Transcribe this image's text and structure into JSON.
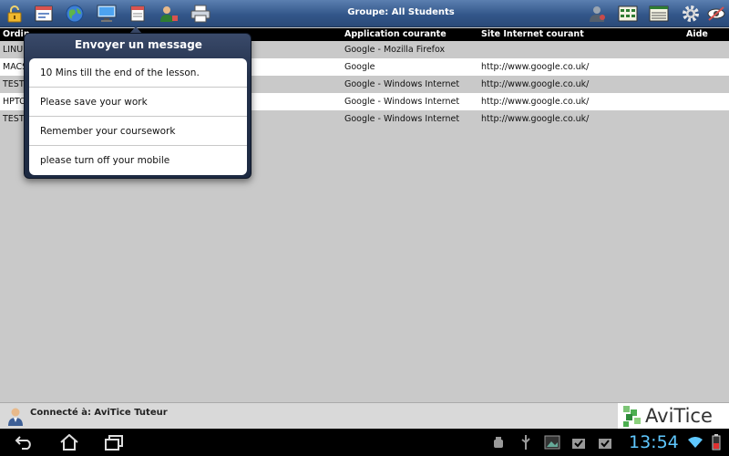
{
  "toolbar": {
    "title": "Groupe: All Students",
    "left_icons": [
      "lock-icon",
      "calendar-window-icon",
      "globe-icon",
      "monitor-icon",
      "message-icon",
      "user-add-icon",
      "printer-icon"
    ],
    "right_icons": [
      "user-settings-icon",
      "grid-view-icon",
      "list-view-icon",
      "gear-icon",
      "eye-off-icon"
    ]
  },
  "table": {
    "columns": [
      "Ordin",
      "Application courante",
      "Site Internet courant",
      "Aide"
    ],
    "rows": [
      {
        "name": "LINU",
        "app": "Google - Mozilla Firefox",
        "site": ""
      },
      {
        "name": "MACS",
        "app": "Google",
        "site": "http://www.google.co.uk/"
      },
      {
        "name": "TEST",
        "app": "Google - Windows Internet",
        "site": "http://www.google.co.uk/"
      },
      {
        "name": "HPTC",
        "app": "Google - Windows Internet",
        "site": "http://www.google.co.uk/"
      },
      {
        "name": "TEST",
        "app": "Google - Windows Internet",
        "site": "http://www.google.co.uk/"
      }
    ]
  },
  "popup": {
    "title": "Envoyer un message",
    "items": [
      "10 Mins till the end of the lesson.",
      "Please save your work",
      "Remember your coursework",
      "please turn off your mobile"
    ]
  },
  "status": {
    "connected_text": "Connecté à: AviTice Tuteur",
    "logo_text": "AviTice"
  },
  "system": {
    "clock": "13:54"
  },
  "colors": {
    "toolbar": "#33578a",
    "popup": "#22304a",
    "clock": "#5fc8ff",
    "logo_green": "#4caf50"
  }
}
